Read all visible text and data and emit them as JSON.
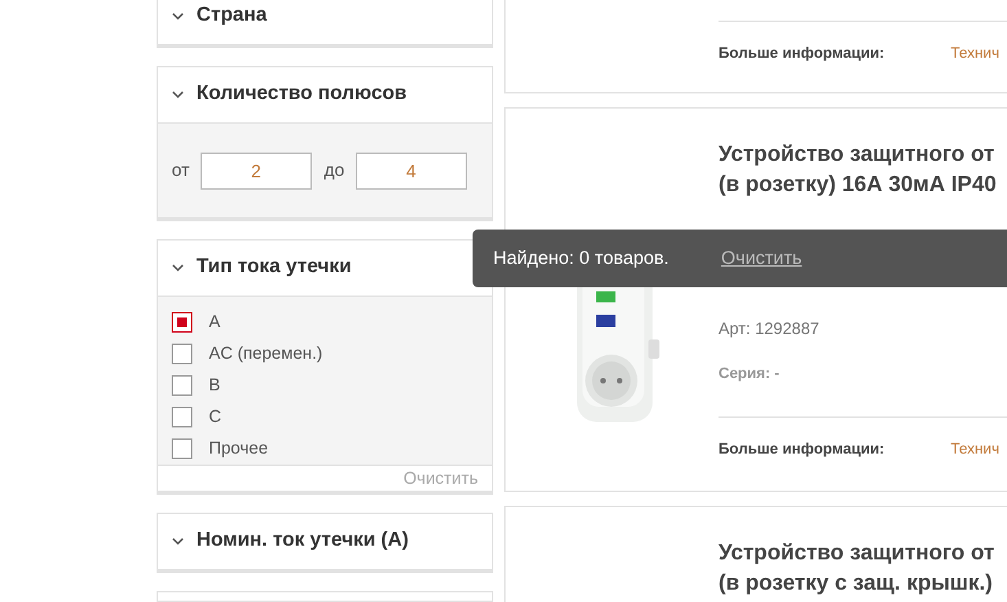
{
  "filters": [
    {
      "kind": "header",
      "title": "Страна",
      "expanded": true
    },
    {
      "kind": "range",
      "title": "Количество полюсов",
      "expanded": true,
      "from_label": "от",
      "from_value": "2",
      "to_label": "до",
      "to_value": "4"
    },
    {
      "kind": "checklist",
      "title": "Тип тока утечки",
      "expanded": true,
      "options": [
        {
          "label": "A",
          "checked": true
        },
        {
          "label": "AC (перемен.)",
          "checked": false
        },
        {
          "label": "B",
          "checked": false
        },
        {
          "label": "C",
          "checked": false
        },
        {
          "label": "Прочее",
          "checked": false
        }
      ],
      "clear": "Очистить"
    },
    {
      "kind": "header",
      "title": "Номин. ток утечки (A)",
      "expanded": true
    }
  ],
  "products": [
    {
      "kind": "tail",
      "more_label": "Больше информации:",
      "more_value": "Технич"
    },
    {
      "kind": "full",
      "title": [
        "Устройство защитного от",
        "(в розетку) 16А 30мА IP40"
      ],
      "article": "Арт: 1292887",
      "series": "Серия: -",
      "more_label": "Больше информации:",
      "more_value": "Технич"
    },
    {
      "kind": "head",
      "title": [
        "Устройство защитного от",
        "(в розетку с защ. крышк.)"
      ]
    }
  ],
  "toast": {
    "message": "Найдено: 0 товаров.",
    "action": "Очистить"
  }
}
